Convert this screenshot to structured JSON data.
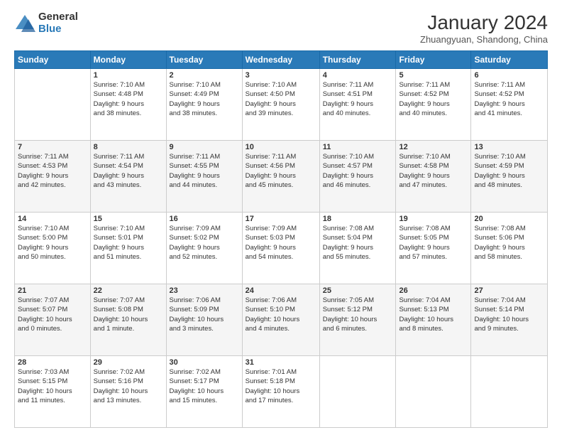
{
  "logo": {
    "general": "General",
    "blue": "Blue"
  },
  "title": "January 2024",
  "subtitle": "Zhuangyuan, Shandong, China",
  "calendar": {
    "headers": [
      "Sunday",
      "Monday",
      "Tuesday",
      "Wednesday",
      "Thursday",
      "Friday",
      "Saturday"
    ],
    "weeks": [
      [
        {
          "day": "",
          "info": ""
        },
        {
          "day": "1",
          "info": "Sunrise: 7:10 AM\nSunset: 4:48 PM\nDaylight: 9 hours\nand 38 minutes."
        },
        {
          "day": "2",
          "info": "Sunrise: 7:10 AM\nSunset: 4:49 PM\nDaylight: 9 hours\nand 38 minutes."
        },
        {
          "day": "3",
          "info": "Sunrise: 7:10 AM\nSunset: 4:50 PM\nDaylight: 9 hours\nand 39 minutes."
        },
        {
          "day": "4",
          "info": "Sunrise: 7:11 AM\nSunset: 4:51 PM\nDaylight: 9 hours\nand 40 minutes."
        },
        {
          "day": "5",
          "info": "Sunrise: 7:11 AM\nSunset: 4:52 PM\nDaylight: 9 hours\nand 40 minutes."
        },
        {
          "day": "6",
          "info": "Sunrise: 7:11 AM\nSunset: 4:52 PM\nDaylight: 9 hours\nand 41 minutes."
        }
      ],
      [
        {
          "day": "7",
          "info": "Sunrise: 7:11 AM\nSunset: 4:53 PM\nDaylight: 9 hours\nand 42 minutes."
        },
        {
          "day": "8",
          "info": "Sunrise: 7:11 AM\nSunset: 4:54 PM\nDaylight: 9 hours\nand 43 minutes."
        },
        {
          "day": "9",
          "info": "Sunrise: 7:11 AM\nSunset: 4:55 PM\nDaylight: 9 hours\nand 44 minutes."
        },
        {
          "day": "10",
          "info": "Sunrise: 7:11 AM\nSunset: 4:56 PM\nDaylight: 9 hours\nand 45 minutes."
        },
        {
          "day": "11",
          "info": "Sunrise: 7:10 AM\nSunset: 4:57 PM\nDaylight: 9 hours\nand 46 minutes."
        },
        {
          "day": "12",
          "info": "Sunrise: 7:10 AM\nSunset: 4:58 PM\nDaylight: 9 hours\nand 47 minutes."
        },
        {
          "day": "13",
          "info": "Sunrise: 7:10 AM\nSunset: 4:59 PM\nDaylight: 9 hours\nand 48 minutes."
        }
      ],
      [
        {
          "day": "14",
          "info": "Sunrise: 7:10 AM\nSunset: 5:00 PM\nDaylight: 9 hours\nand 50 minutes."
        },
        {
          "day": "15",
          "info": "Sunrise: 7:10 AM\nSunset: 5:01 PM\nDaylight: 9 hours\nand 51 minutes."
        },
        {
          "day": "16",
          "info": "Sunrise: 7:09 AM\nSunset: 5:02 PM\nDaylight: 9 hours\nand 52 minutes."
        },
        {
          "day": "17",
          "info": "Sunrise: 7:09 AM\nSunset: 5:03 PM\nDaylight: 9 hours\nand 54 minutes."
        },
        {
          "day": "18",
          "info": "Sunrise: 7:08 AM\nSunset: 5:04 PM\nDaylight: 9 hours\nand 55 minutes."
        },
        {
          "day": "19",
          "info": "Sunrise: 7:08 AM\nSunset: 5:05 PM\nDaylight: 9 hours\nand 57 minutes."
        },
        {
          "day": "20",
          "info": "Sunrise: 7:08 AM\nSunset: 5:06 PM\nDaylight: 9 hours\nand 58 minutes."
        }
      ],
      [
        {
          "day": "21",
          "info": "Sunrise: 7:07 AM\nSunset: 5:07 PM\nDaylight: 10 hours\nand 0 minutes."
        },
        {
          "day": "22",
          "info": "Sunrise: 7:07 AM\nSunset: 5:08 PM\nDaylight: 10 hours\nand 1 minute."
        },
        {
          "day": "23",
          "info": "Sunrise: 7:06 AM\nSunset: 5:09 PM\nDaylight: 10 hours\nand 3 minutes."
        },
        {
          "day": "24",
          "info": "Sunrise: 7:06 AM\nSunset: 5:10 PM\nDaylight: 10 hours\nand 4 minutes."
        },
        {
          "day": "25",
          "info": "Sunrise: 7:05 AM\nSunset: 5:12 PM\nDaylight: 10 hours\nand 6 minutes."
        },
        {
          "day": "26",
          "info": "Sunrise: 7:04 AM\nSunset: 5:13 PM\nDaylight: 10 hours\nand 8 minutes."
        },
        {
          "day": "27",
          "info": "Sunrise: 7:04 AM\nSunset: 5:14 PM\nDaylight: 10 hours\nand 9 minutes."
        }
      ],
      [
        {
          "day": "28",
          "info": "Sunrise: 7:03 AM\nSunset: 5:15 PM\nDaylight: 10 hours\nand 11 minutes."
        },
        {
          "day": "29",
          "info": "Sunrise: 7:02 AM\nSunset: 5:16 PM\nDaylight: 10 hours\nand 13 minutes."
        },
        {
          "day": "30",
          "info": "Sunrise: 7:02 AM\nSunset: 5:17 PM\nDaylight: 10 hours\nand 15 minutes."
        },
        {
          "day": "31",
          "info": "Sunrise: 7:01 AM\nSunset: 5:18 PM\nDaylight: 10 hours\nand 17 minutes."
        },
        {
          "day": "",
          "info": ""
        },
        {
          "day": "",
          "info": ""
        },
        {
          "day": "",
          "info": ""
        }
      ]
    ]
  }
}
